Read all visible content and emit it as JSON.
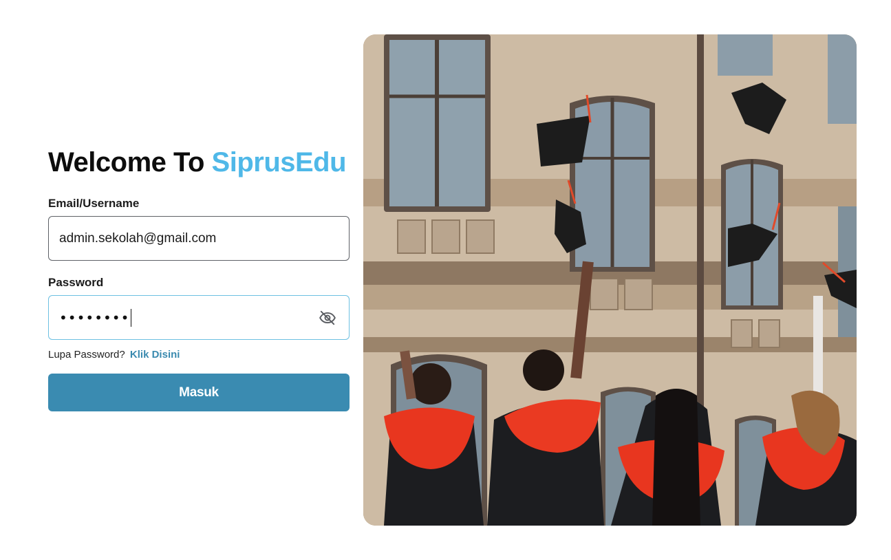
{
  "header": {
    "title_prefix": "Welcome To",
    "title_brand": "SiprusEdu"
  },
  "form": {
    "email_label": "Email/Username",
    "email_value": "admin.sekolah@gmail.com",
    "password_label": "Password",
    "password_masked": "••••••••",
    "password_toggle_icon": "eye-off-icon",
    "forgot_text": "Lupa Password?",
    "forgot_link": "Klik Disini",
    "submit_label": "Masuk"
  },
  "hero": {
    "image_subject": "graduates throwing caps in front of brick building"
  },
  "colors": {
    "brand": "#4fb8e8",
    "button": "#3a8bb1",
    "link": "#3a8aaf",
    "focus_border": "#6cc0e2"
  }
}
